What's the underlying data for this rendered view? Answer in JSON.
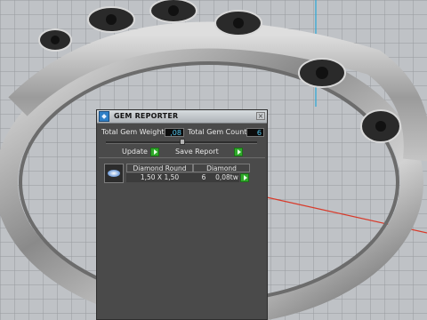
{
  "panel": {
    "title": "GEM REPORTER",
    "close_glyph": "×",
    "total_gem_weight_label": "Total Gem Weight",
    "total_gem_weight_value": ",08",
    "total_gem_count_label": "Total Gem Count",
    "total_gem_count_value": "6",
    "update_label": "Update",
    "save_report_label": "Save Report"
  },
  "gem_table": {
    "headers": [
      "Diamond Round",
      "Diamond"
    ],
    "rows": [
      {
        "size": "1,50 X 1,50",
        "count": "6",
        "weight": "0,08tw"
      }
    ]
  },
  "icons": {
    "app": "gem-reporter-app-icon",
    "close": "close-icon",
    "arrow": "green-arrow-icon",
    "gem": "round-diamond-icon"
  },
  "colors": {
    "panel_bg": "#4a4a4a",
    "value_text": "#53c8f0",
    "arrow_button": "#2faa2a"
  }
}
